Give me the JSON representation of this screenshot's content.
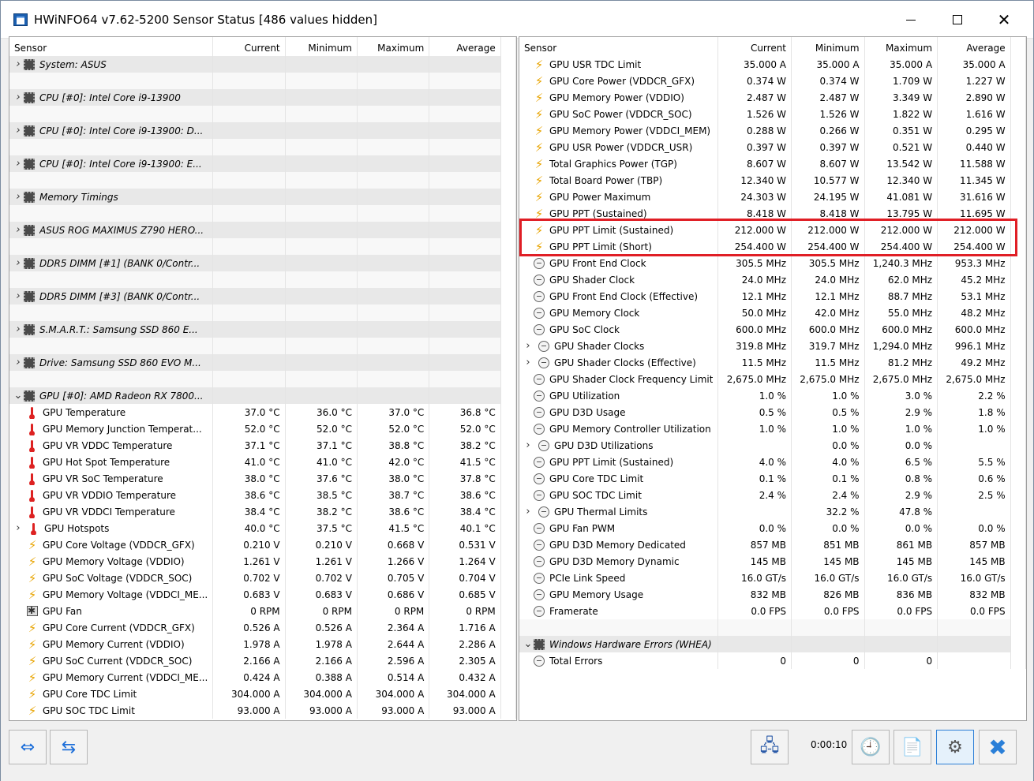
{
  "title": "HWiNFO64 v7.62-5200 Sensor Status [486 values hidden]",
  "window_controls": {
    "minimize": "",
    "maximize": "",
    "close": "✕"
  },
  "columns": [
    "Sensor",
    "Current",
    "Minimum",
    "Maximum",
    "Average"
  ],
  "left_rows": [
    {
      "kind": "group",
      "expander": ">",
      "icon": "chip-icon",
      "name": "System: ASUS"
    },
    {
      "kind": "spacer"
    },
    {
      "kind": "group",
      "expander": ">",
      "icon": "chip-icon",
      "name": "CPU [#0]: Intel Core i9-13900"
    },
    {
      "kind": "spacer"
    },
    {
      "kind": "group",
      "expander": ">",
      "icon": "chip-icon",
      "name": "CPU [#0]: Intel Core i9-13900: D..."
    },
    {
      "kind": "spacer"
    },
    {
      "kind": "group",
      "expander": ">",
      "icon": "chip-icon",
      "name": "CPU [#0]: Intel Core i9-13900: E..."
    },
    {
      "kind": "spacer"
    },
    {
      "kind": "group",
      "expander": ">",
      "icon": "chip-icon",
      "name": "Memory Timings"
    },
    {
      "kind": "spacer"
    },
    {
      "kind": "group",
      "expander": ">",
      "icon": "chip-icon",
      "name": "ASUS ROG MAXIMUS Z790 HERO..."
    },
    {
      "kind": "spacer"
    },
    {
      "kind": "group",
      "expander": ">",
      "icon": "chip-icon",
      "name": "DDR5 DIMM [#1] (BANK 0/Contr..."
    },
    {
      "kind": "spacer"
    },
    {
      "kind": "group",
      "expander": ">",
      "icon": "chip-icon",
      "name": "DDR5 DIMM [#3] (BANK 0/Contr..."
    },
    {
      "kind": "spacer"
    },
    {
      "kind": "group",
      "expander": ">",
      "icon": "chip-icon",
      "name": "S.M.A.R.T.: Samsung SSD 860 E..."
    },
    {
      "kind": "spacer"
    },
    {
      "kind": "group",
      "expander": ">",
      "icon": "chip-icon",
      "name": "Drive: Samsung SSD 860 EVO M..."
    },
    {
      "kind": "spacer"
    },
    {
      "kind": "group",
      "expander": "v",
      "icon": "chip-icon",
      "name": "GPU [#0]: AMD Radeon RX 7800..."
    },
    {
      "kind": "item",
      "icon": "thermometer-icon",
      "name": "GPU Temperature",
      "cur": "37.0 °C",
      "min": "36.0 °C",
      "max": "37.0 °C",
      "avg": "36.8 °C"
    },
    {
      "kind": "item",
      "icon": "thermometer-icon",
      "name": "GPU Memory Junction Temperat...",
      "cur": "52.0 °C",
      "min": "52.0 °C",
      "max": "52.0 °C",
      "avg": "52.0 °C"
    },
    {
      "kind": "item",
      "icon": "thermometer-icon",
      "name": "GPU VR VDDC Temperature",
      "cur": "37.1 °C",
      "min": "37.1 °C",
      "max": "38.8 °C",
      "avg": "38.2 °C"
    },
    {
      "kind": "item",
      "icon": "thermometer-icon",
      "name": "GPU Hot Spot Temperature",
      "cur": "41.0 °C",
      "min": "41.0 °C",
      "max": "42.0 °C",
      "avg": "41.5 °C"
    },
    {
      "kind": "item",
      "icon": "thermometer-icon",
      "name": "GPU VR SoC Temperature",
      "cur": "38.0 °C",
      "min": "37.6 °C",
      "max": "38.0 °C",
      "avg": "37.8 °C"
    },
    {
      "kind": "item",
      "icon": "thermometer-icon",
      "name": "GPU VR VDDIO Temperature",
      "cur": "38.6 °C",
      "min": "38.5 °C",
      "max": "38.7 °C",
      "avg": "38.6 °C"
    },
    {
      "kind": "item",
      "icon": "thermometer-icon",
      "name": "GPU VR VDDCI Temperature",
      "cur": "38.4 °C",
      "min": "38.2 °C",
      "max": "38.6 °C",
      "avg": "38.4 °C"
    },
    {
      "kind": "item",
      "expander": ">",
      "icon": "thermometer-icon",
      "name": "GPU Hotspots",
      "cur": "40.0 °C",
      "min": "37.5 °C",
      "max": "41.5 °C",
      "avg": "40.1 °C"
    },
    {
      "kind": "item",
      "icon": "lightning-icon",
      "name": "GPU Core Voltage (VDDCR_GFX)",
      "cur": "0.210 V",
      "min": "0.210 V",
      "max": "0.668 V",
      "avg": "0.531 V"
    },
    {
      "kind": "item",
      "icon": "lightning-icon",
      "name": "GPU Memory Voltage (VDDIO)",
      "cur": "1.261 V",
      "min": "1.261 V",
      "max": "1.266 V",
      "avg": "1.264 V"
    },
    {
      "kind": "item",
      "icon": "lightning-icon",
      "name": "GPU SoC Voltage (VDDCR_SOC)",
      "cur": "0.702 V",
      "min": "0.702 V",
      "max": "0.705 V",
      "avg": "0.704 V"
    },
    {
      "kind": "item",
      "icon": "lightning-icon",
      "name": "GPU Memory Voltage (VDDCI_ME...",
      "cur": "0.683 V",
      "min": "0.683 V",
      "max": "0.686 V",
      "avg": "0.685 V"
    },
    {
      "kind": "item",
      "icon": "fan-icon",
      "name": "GPU Fan",
      "cur": "0 RPM",
      "min": "0 RPM",
      "max": "0 RPM",
      "avg": "0 RPM"
    },
    {
      "kind": "item",
      "icon": "lightning-icon",
      "name": "GPU Core Current (VDDCR_GFX)",
      "cur": "0.526 A",
      "min": "0.526 A",
      "max": "2.364 A",
      "avg": "1.716 A"
    },
    {
      "kind": "item",
      "icon": "lightning-icon",
      "name": "GPU Memory Current (VDDIO)",
      "cur": "1.978 A",
      "min": "1.978 A",
      "max": "2.644 A",
      "avg": "2.286 A"
    },
    {
      "kind": "item",
      "icon": "lightning-icon",
      "name": "GPU SoC Current (VDDCR_SOC)",
      "cur": "2.166 A",
      "min": "2.166 A",
      "max": "2.596 A",
      "avg": "2.305 A"
    },
    {
      "kind": "item",
      "icon": "lightning-icon",
      "name": "GPU Memory Current (VDDCI_ME...",
      "cur": "0.424 A",
      "min": "0.388 A",
      "max": "0.514 A",
      "avg": "0.432 A"
    },
    {
      "kind": "item",
      "icon": "lightning-icon",
      "name": "GPU Core TDC Limit",
      "cur": "304.000 A",
      "min": "304.000 A",
      "max": "304.000 A",
      "avg": "304.000 A"
    },
    {
      "kind": "item",
      "icon": "lightning-icon",
      "name": "GPU SOC TDC Limit",
      "cur": "93.000 A",
      "min": "93.000 A",
      "max": "93.000 A",
      "avg": "93.000 A"
    }
  ],
  "right_rows": [
    {
      "kind": "item",
      "icon": "lightning-icon",
      "name": "GPU USR TDC Limit",
      "cur": "35.000 A",
      "min": "35.000 A",
      "max": "35.000 A",
      "avg": "35.000 A"
    },
    {
      "kind": "item",
      "icon": "lightning-icon",
      "name": "GPU Core Power (VDDCR_GFX)",
      "cur": "0.374 W",
      "min": "0.374 W",
      "max": "1.709 W",
      "avg": "1.227 W"
    },
    {
      "kind": "item",
      "icon": "lightning-icon",
      "name": "GPU Memory Power (VDDIO)",
      "cur": "2.487 W",
      "min": "2.487 W",
      "max": "3.349 W",
      "avg": "2.890 W"
    },
    {
      "kind": "item",
      "icon": "lightning-icon",
      "name": "GPU SoC Power (VDDCR_SOC)",
      "cur": "1.526 W",
      "min": "1.526 W",
      "max": "1.822 W",
      "avg": "1.616 W"
    },
    {
      "kind": "item",
      "icon": "lightning-icon",
      "name": "GPU Memory Power (VDDCI_MEM)",
      "cur": "0.288 W",
      "min": "0.266 W",
      "max": "0.351 W",
      "avg": "0.295 W"
    },
    {
      "kind": "item",
      "icon": "lightning-icon",
      "name": "GPU USR Power (VDDCR_USR)",
      "cur": "0.397 W",
      "min": "0.397 W",
      "max": "0.521 W",
      "avg": "0.440 W"
    },
    {
      "kind": "item",
      "icon": "lightning-icon",
      "name": "Total Graphics Power (TGP)",
      "cur": "8.607 W",
      "min": "8.607 W",
      "max": "13.542 W",
      "avg": "11.588 W"
    },
    {
      "kind": "item",
      "icon": "lightning-icon",
      "name": "Total Board Power (TBP)",
      "cur": "12.340 W",
      "min": "10.577 W",
      "max": "12.340 W",
      "avg": "11.345 W"
    },
    {
      "kind": "item",
      "icon": "lightning-icon",
      "name": "GPU Power Maximum",
      "cur": "24.303 W",
      "min": "24.195 W",
      "max": "41.081 W",
      "avg": "31.616 W"
    },
    {
      "kind": "item",
      "icon": "lightning-icon",
      "name": "GPU PPT (Sustained)",
      "cur": "8.418 W",
      "min": "8.418 W",
      "max": "13.795 W",
      "avg": "11.695 W"
    },
    {
      "kind": "item",
      "icon": "lightning-icon",
      "name": "GPU PPT Limit (Sustained)",
      "cur": "212.000 W",
      "min": "212.000 W",
      "max": "212.000 W",
      "avg": "212.000 W"
    },
    {
      "kind": "item",
      "icon": "lightning-icon",
      "name": "GPU PPT Limit (Short)",
      "cur": "254.400 W",
      "min": "254.400 W",
      "max": "254.400 W",
      "avg": "254.400 W"
    },
    {
      "kind": "item",
      "icon": "clock-icon",
      "name": "GPU Front End Clock",
      "cur": "305.5 MHz",
      "min": "305.5 MHz",
      "max": "1,240.3 MHz",
      "avg": "953.3 MHz"
    },
    {
      "kind": "item",
      "icon": "clock-icon",
      "name": "GPU Shader Clock",
      "cur": "24.0 MHz",
      "min": "24.0 MHz",
      "max": "62.0 MHz",
      "avg": "45.2 MHz"
    },
    {
      "kind": "item",
      "icon": "clock-icon",
      "name": "GPU Front End Clock (Effective)",
      "cur": "12.1 MHz",
      "min": "12.1 MHz",
      "max": "88.7 MHz",
      "avg": "53.1 MHz"
    },
    {
      "kind": "item",
      "icon": "clock-icon",
      "name": "GPU Memory Clock",
      "cur": "50.0 MHz",
      "min": "42.0 MHz",
      "max": "55.0 MHz",
      "avg": "48.2 MHz"
    },
    {
      "kind": "item",
      "icon": "clock-icon",
      "name": "GPU SoC Clock",
      "cur": "600.0 MHz",
      "min": "600.0 MHz",
      "max": "600.0 MHz",
      "avg": "600.0 MHz"
    },
    {
      "kind": "item",
      "expander": ">",
      "icon": "clock-icon",
      "name": "GPU Shader Clocks",
      "cur": "319.8 MHz",
      "min": "319.7 MHz",
      "max": "1,294.0 MHz",
      "avg": "996.1 MHz"
    },
    {
      "kind": "item",
      "expander": ">",
      "icon": "clock-icon",
      "name": "GPU Shader Clocks (Effective)",
      "cur": "11.5 MHz",
      "min": "11.5 MHz",
      "max": "81.2 MHz",
      "avg": "49.2 MHz"
    },
    {
      "kind": "item",
      "icon": "clock-icon",
      "name": "GPU Shader Clock Frequency Limit",
      "cur": "2,675.0 MHz",
      "min": "2,675.0 MHz",
      "max": "2,675.0 MHz",
      "avg": "2,675.0 MHz"
    },
    {
      "kind": "item",
      "icon": "clock-icon",
      "name": "GPU Utilization",
      "cur": "1.0 %",
      "min": "1.0 %",
      "max": "3.0 %",
      "avg": "2.2 %"
    },
    {
      "kind": "item",
      "icon": "clock-icon",
      "name": "GPU D3D Usage",
      "cur": "0.5 %",
      "min": "0.5 %",
      "max": "2.9 %",
      "avg": "1.8 %"
    },
    {
      "kind": "item",
      "icon": "clock-icon",
      "name": "GPU Memory Controller Utilization",
      "cur": "1.0 %",
      "min": "1.0 %",
      "max": "1.0 %",
      "avg": "1.0 %"
    },
    {
      "kind": "item",
      "expander": ">",
      "icon": "clock-icon",
      "name": "GPU D3D Utilizations",
      "cur": "",
      "min": "0.0 %",
      "max": "0.0 %",
      "avg": ""
    },
    {
      "kind": "item",
      "icon": "clock-icon",
      "name": "GPU PPT Limit (Sustained)",
      "cur": "4.0 %",
      "min": "4.0 %",
      "max": "6.5 %",
      "avg": "5.5 %"
    },
    {
      "kind": "item",
      "icon": "clock-icon",
      "name": "GPU Core TDC Limit",
      "cur": "0.1 %",
      "min": "0.1 %",
      "max": "0.8 %",
      "avg": "0.6 %"
    },
    {
      "kind": "item",
      "icon": "clock-icon",
      "name": "GPU SOC TDC Limit",
      "cur": "2.4 %",
      "min": "2.4 %",
      "max": "2.9 %",
      "avg": "2.5 %"
    },
    {
      "kind": "item",
      "expander": ">",
      "icon": "clock-icon",
      "name": "GPU Thermal Limits",
      "cur": "",
      "min": "32.2 %",
      "max": "47.8 %",
      "avg": ""
    },
    {
      "kind": "item",
      "icon": "clock-icon",
      "name": "GPU Fan PWM",
      "cur": "0.0 %",
      "min": "0.0 %",
      "max": "0.0 %",
      "avg": "0.0 %"
    },
    {
      "kind": "item",
      "icon": "clock-icon",
      "name": "GPU D3D Memory Dedicated",
      "cur": "857 MB",
      "min": "851 MB",
      "max": "861 MB",
      "avg": "857 MB"
    },
    {
      "kind": "item",
      "icon": "clock-icon",
      "name": "GPU D3D Memory Dynamic",
      "cur": "145 MB",
      "min": "145 MB",
      "max": "145 MB",
      "avg": "145 MB"
    },
    {
      "kind": "item",
      "icon": "clock-icon",
      "name": "PCIe Link Speed",
      "cur": "16.0 GT/s",
      "min": "16.0 GT/s",
      "max": "16.0 GT/s",
      "avg": "16.0 GT/s"
    },
    {
      "kind": "item",
      "icon": "clock-icon",
      "name": "GPU Memory Usage",
      "cur": "832 MB",
      "min": "826 MB",
      "max": "836 MB",
      "avg": "832 MB"
    },
    {
      "kind": "item",
      "icon": "clock-icon",
      "name": "Framerate",
      "cur": "0.0 FPS",
      "min": "0.0 FPS",
      "max": "0.0 FPS",
      "avg": "0.0 FPS"
    },
    {
      "kind": "spacer"
    },
    {
      "kind": "group",
      "expander": "v",
      "icon": "chip-icon",
      "name": "Windows Hardware Errors (WHEA)"
    },
    {
      "kind": "item",
      "icon": "clock-icon",
      "name": "Total Errors",
      "cur": "0",
      "min": "0",
      "max": "0",
      "avg": ""
    }
  ],
  "toolbar": {
    "timer": "0:00:10",
    "expand_icon": "⇔",
    "collapse_icon": "⇆",
    "network_icon": "🖧",
    "clock_icon": "🕘",
    "report_icon": "📄",
    "settings_icon": "⚙",
    "close_icon": "✖"
  },
  "colors": {
    "highlight": "#e01e25",
    "group_bg": "#e8e8e8",
    "bolt": "#e8a400",
    "thermometer": "#dd2222"
  }
}
